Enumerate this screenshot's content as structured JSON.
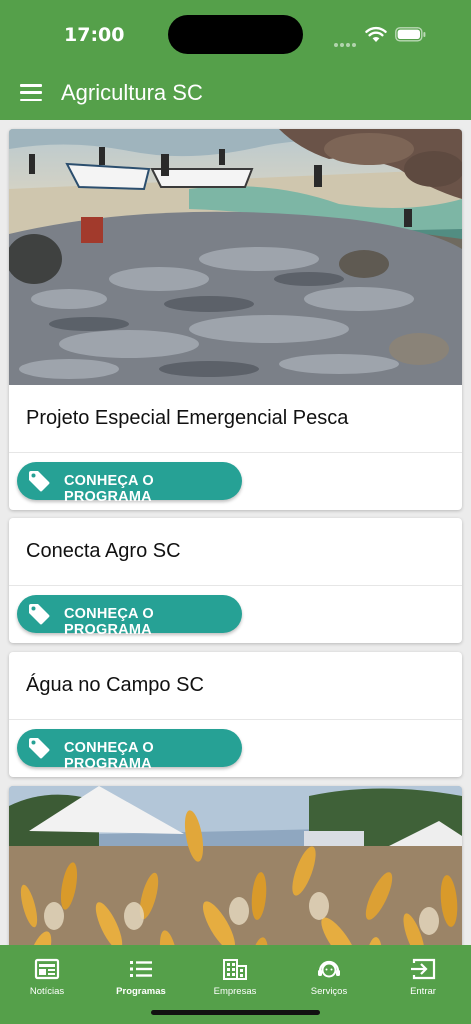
{
  "status_bar": {
    "time": "17:00"
  },
  "app_bar": {
    "title": "Agricultura SC"
  },
  "cards": [
    {
      "title": "Projeto Especial Emergencial Pesca",
      "button_label": "CONHEÇA O PROGRAMA"
    },
    {
      "title": "Conecta Agro SC",
      "button_label": "CONHEÇA O PROGRAMA"
    },
    {
      "title": "Água no Campo SC",
      "button_label": "CONHEÇA O PROGRAMA"
    }
  ],
  "bottom_nav": [
    {
      "label": "Notícias",
      "icon": "newspaper-icon"
    },
    {
      "label": "Programas",
      "icon": "list-icon",
      "active": true
    },
    {
      "label": "Empresas",
      "icon": "building-icon"
    },
    {
      "label": "Serviços",
      "icon": "support-agent-icon"
    },
    {
      "label": "Entrar",
      "icon": "login-icon"
    }
  ],
  "colors": {
    "primary": "#55a04a",
    "accent": "#26a195"
  }
}
